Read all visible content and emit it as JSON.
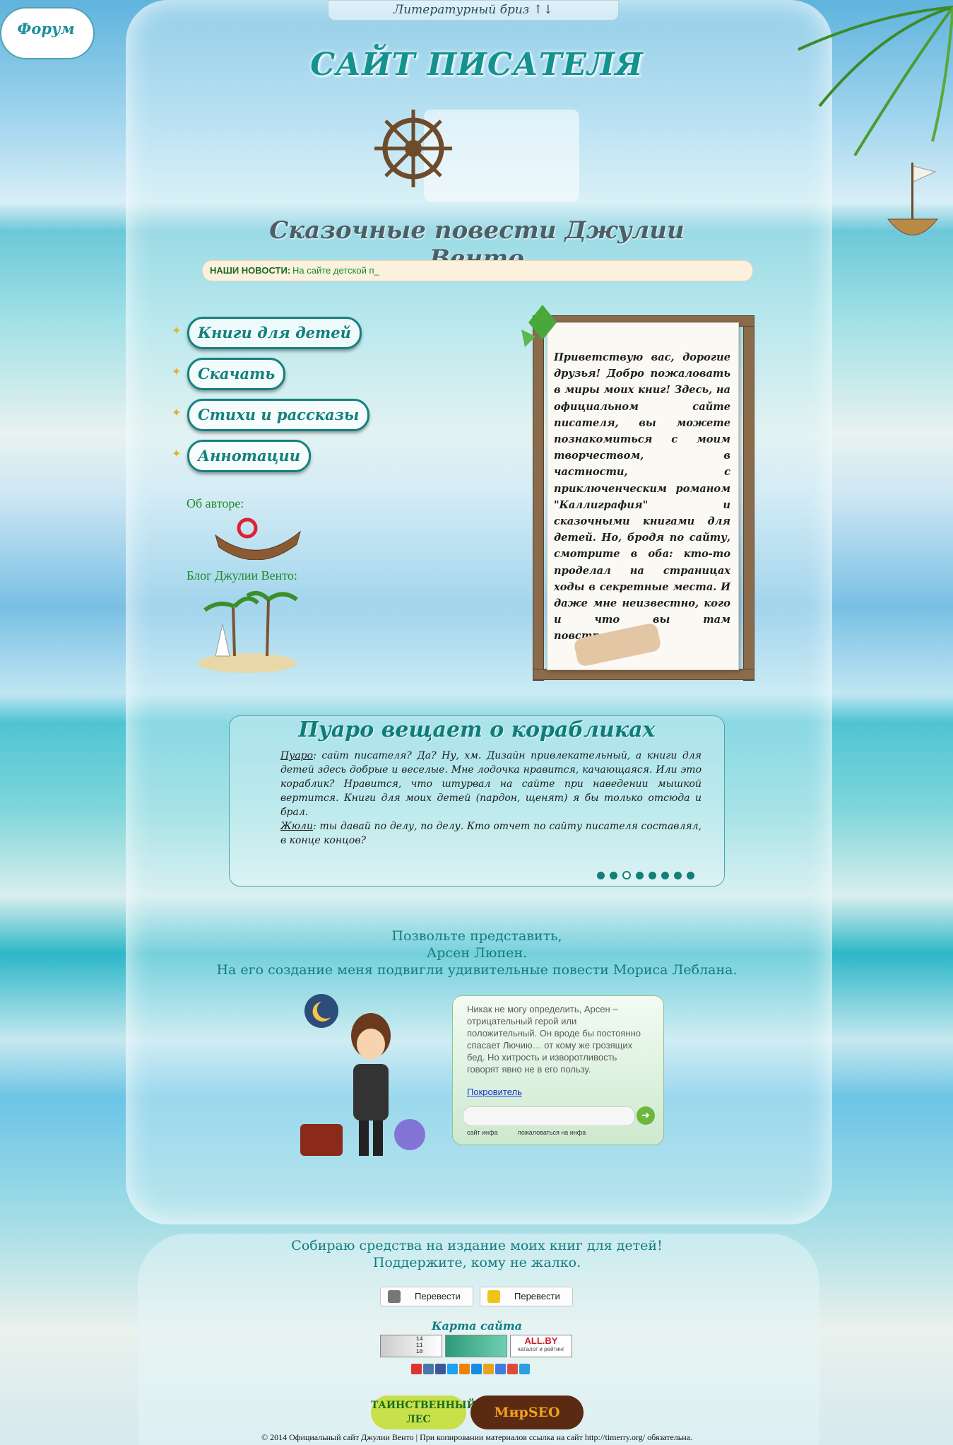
{
  "top_bar": {
    "label": "Литературный бриз ↑↓"
  },
  "forum": {
    "label": "Форум"
  },
  "header": {
    "site_title": "САЙТ ПИСАТЕЛЯ",
    "subtitle": "Сказочные повести Джулии Венто"
  },
  "news": {
    "label": "НАШИ НОВОСТИ:",
    "text": "На сайте детской п_"
  },
  "menu": [
    {
      "label": "Книги для детей"
    },
    {
      "label": "Скачать"
    },
    {
      "label": "Стихи и рассказы"
    },
    {
      "label": "Аннотации"
    }
  ],
  "sidebar": {
    "about_label": "Об авторе:",
    "blog_label": "Блог Джулии Венто:"
  },
  "welcome": {
    "text": "Приветствую вас, дорогие друзья! Добро пожаловать в миры моих книг! Здесь, на официальном сайте писателя, вы можете познакомиться с моим творчеством, в частности, с приключенческим романом \"Каллиграфия\" и сказочными книгами для детей. Но, бродя по сайту, смотрите в оба: кто-то проделал на страницах ходы в секретные места. И даже мне неизвестно, кого и что вы там повстречаете."
  },
  "poirot": {
    "title": "Пуаро вещает о корабликах",
    "speaker1": "Пуаро",
    "line1": ": сайт писателя? Да? Ну, хм. Дизайн привлекательный, а книги для детей здесь добрые и веселые. Мне лодочка нравится, качающаяся. Или это кораблик? Нравится, что штурвал на сайте при наведении мышкой вертится. Книги для моих детей (пардон, щенят) я бы только отсюда и брал.",
    "speaker2": "Жюли",
    "line2": ": ты давай по делу, по делу. Кто отчет по сайту писателя составлял, в конце концов?",
    "slides": 8,
    "active_slide": 3
  },
  "intro": {
    "line1": "Позвольте представить,",
    "line2": "Арсен Люпен.",
    "line3": "На его создание меня подвигли удивительные повести Мориса Леблана."
  },
  "chat": {
    "message": "Никак не могу определить, Арсен – отрицательный герой или положительный. Он вроде бы постоянно спасает Лючию… от кому же грозящих бед. Но хитрость и изворотливость говорят явно не в его пользу.",
    "author": "Покровитель",
    "input_value": "",
    "footer_left": "сайт инфа",
    "footer_right": "пожаловаться на инфа"
  },
  "donate": {
    "line1": "Собираю средства на издание моих книг для детей!",
    "line2": "Поддержите, кому не жалко.",
    "button1": "Перевести",
    "button2": "Перевести"
  },
  "sitemap": {
    "label": "Карта сайта"
  },
  "counters": {
    "c1": "14\n11\n10",
    "allby_title": "ALL.BY",
    "allby_sub": "каталог и рейтинг"
  },
  "badges": {
    "b1": "ТАИНСТВЕННЫЙ ЛЕС",
    "b2": "МирSEO"
  },
  "footer": {
    "text": "© 2014 Официальный сайт Джулии Венто | При копировании материалов ссылка на сайт http://timerry.org/ обязательна."
  },
  "colors": {
    "accent": "#14807f",
    "title": "#13928f",
    "news_bg": "#fbf1dc"
  }
}
